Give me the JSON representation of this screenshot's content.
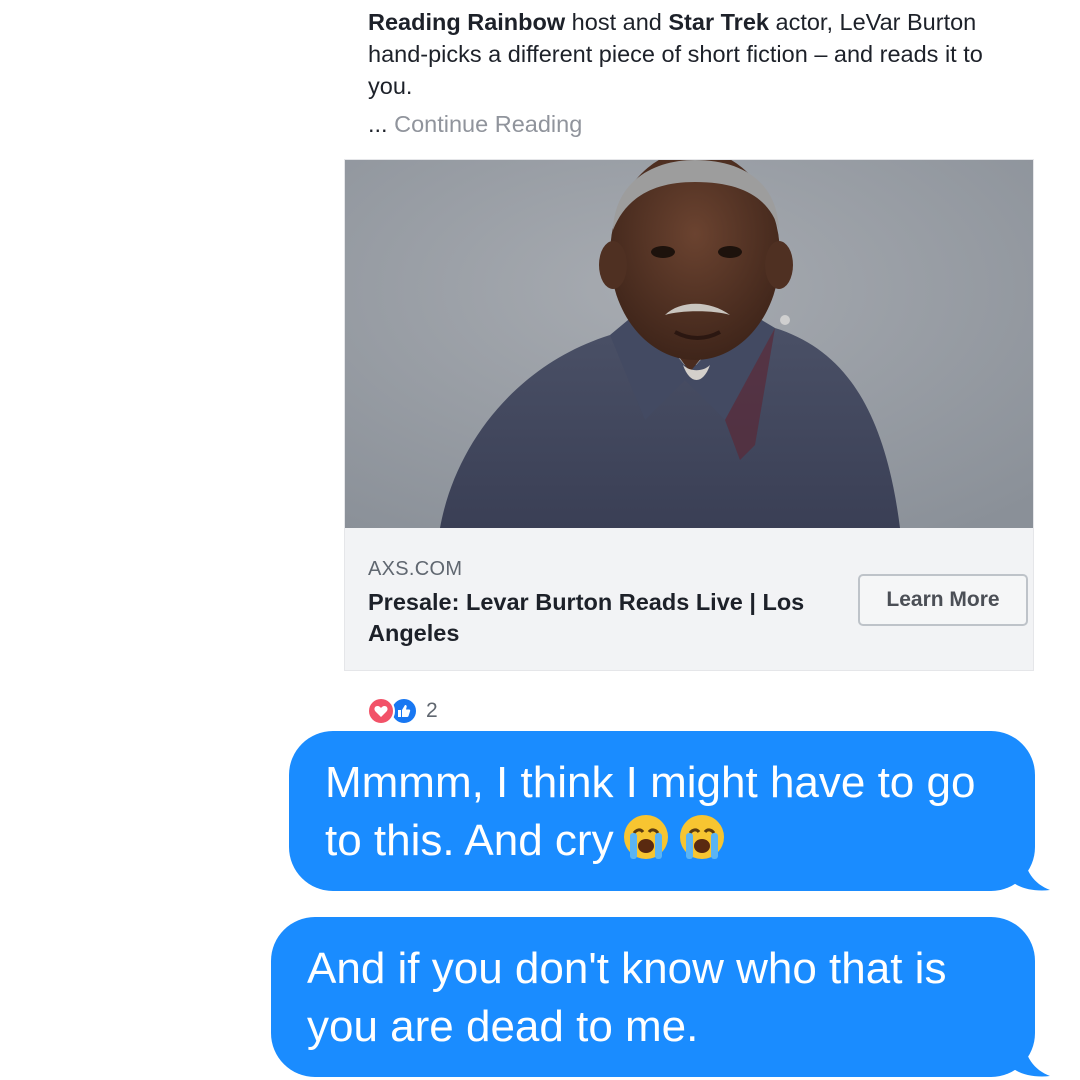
{
  "post": {
    "text_bold_1": "Reading Rainbow",
    "text_1": " host and ",
    "text_bold_2": "Star Trek",
    "text_2": " actor, LeVar Burton hand-picks a different piece of short fiction – and reads it to you.",
    "ellipsis": "... ",
    "continue_reading": "Continue Reading"
  },
  "link_card": {
    "domain": "AXS.COM",
    "title": "Presale: Levar Burton Reads Live | Los Angeles",
    "cta_label": "Learn More"
  },
  "reactions": {
    "icons": [
      "love-icon",
      "like-icon"
    ],
    "count": "2"
  },
  "messages": [
    {
      "text": "Mmmm, I think I might have to go to this. And cry",
      "emoji": [
        "loudly-crying-face-emoji",
        "loudly-crying-face-emoji"
      ]
    },
    {
      "text": "And if you don't know who that is you are dead to me."
    }
  ],
  "colors": {
    "bubble_blue": "#1a8cff",
    "link_gray": "#90949c",
    "love_red": "#f25268",
    "like_blue": "#1877f2"
  }
}
